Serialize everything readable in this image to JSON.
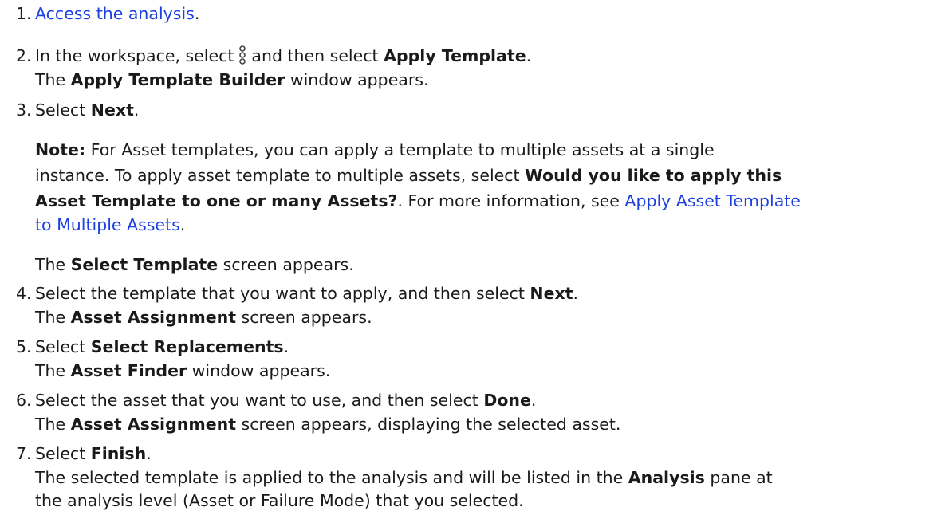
{
  "steps": [
    {
      "number": "1.",
      "link": "Access the analysis",
      "after": "."
    },
    {
      "number": "2.",
      "pre": "In the workspace, select",
      "icon": "kebab-menu-icon",
      "mid": "and then select",
      "bold": "Apply Template",
      "end": ".",
      "result_pre": "The",
      "result_bold": "Apply Template Builder",
      "result_post": "window appears."
    },
    {
      "number": "3.",
      "pre": "Select",
      "bold": "Next",
      "end": ".",
      "note": {
        "label": "Note:",
        "text1": "For Asset templates, you can apply a template to multiple assets at a single",
        "text2": "instance. To apply asset template to multiple assets, select",
        "bold1": "Would you like to apply this",
        "bold2": "Asset Template to one or many Assets?",
        "text3": ". For more information, see",
        "link1": "Apply Asset Template",
        "link2": "to Multiple Assets",
        "end": "."
      },
      "result_pre": "The",
      "result_bold": "Select Template",
      "result_post": "screen appears."
    },
    {
      "number": "4.",
      "pre": "Select the template that you want to apply, and then select",
      "bold": "Next",
      "end": ".",
      "result_pre": "The",
      "result_bold": "Asset Assignment",
      "result_post": "screen appears."
    },
    {
      "number": "5.",
      "pre": "Select",
      "bold": "Select Replacements",
      "end": ".",
      "result_pre": "The",
      "result_bold": "Asset Finder",
      "result_post": "window appears."
    },
    {
      "number": "6.",
      "pre": "Select the asset that you want to use, and then select",
      "bold": "Done",
      "end": ".",
      "result_pre": "The",
      "result_bold": "Asset Assignment",
      "result_post": "screen appears, displaying the selected asset."
    },
    {
      "number": "7.",
      "pre": "Select",
      "bold": "Finish",
      "end": ".",
      "result_line1_pre": "The selected template is applied to the analysis and will be listed in the",
      "result_line1_bold": "Analysis",
      "result_line1_post": "pane at",
      "result_line2": "the analysis level (Asset or Failure Mode) that you selected."
    }
  ]
}
